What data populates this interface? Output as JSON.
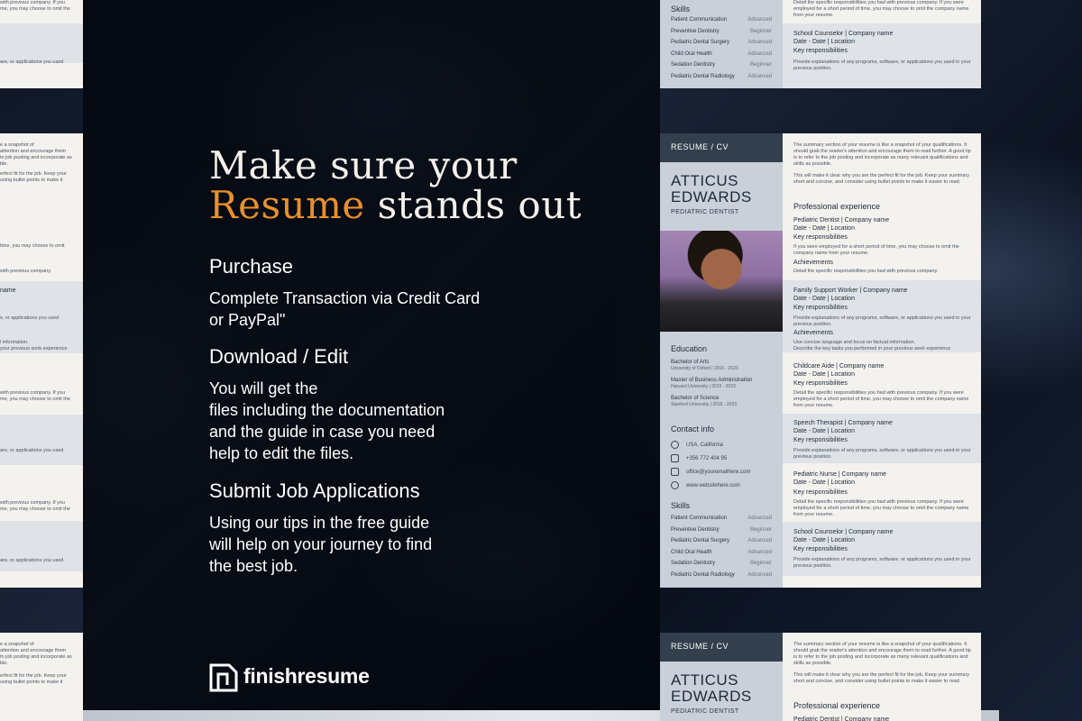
{
  "headline": {
    "line1": "Make sure your",
    "accent": "Resume",
    "rest": " stands out"
  },
  "steps": [
    {
      "title": "Purchase",
      "body": "Complete Transaction via Credit Card\nor PayPal\""
    },
    {
      "title": "Download / Edit",
      "body": "You will get the\nfiles including the documentation\nand the guide in case you need\nhelp to edit the files."
    },
    {
      "title": "Submit Job Applications",
      "body": "Using our tips in the free guide\nwill help on your journey to find\nthe best job."
    }
  ],
  "brand": {
    "name": "finishresume"
  },
  "resume": {
    "header": "RESUME / CV",
    "first_name": "ATTICUS",
    "last_name": "EDWARDS",
    "role": "PEDIATRIC DENTIST",
    "education_title": "Education",
    "education": [
      {
        "degree": "Bachelor of Arts",
        "school": "University of Oxford | 2016 - 2023"
      },
      {
        "degree": "Master of Business Administration",
        "school": "Harvard University | 2016 - 2023"
      },
      {
        "degree": "Bachelor of Science",
        "school": "Stanford University | 2016 - 2023"
      }
    ],
    "contact_title": "Contact info",
    "contact": [
      "USA, California",
      "+356 772 404 95",
      "office@youremailhere.com",
      "www.websitehere.com"
    ],
    "skills_title": "Skills",
    "skills": [
      {
        "name": "Patient Communication",
        "level": "Advanced"
      },
      {
        "name": "Preventive Dentistry",
        "level": "Beginner"
      },
      {
        "name": "Pediatric Dental Surgery",
        "level": "Advanced"
      },
      {
        "name": "Child Oral Health",
        "level": "Advanced"
      },
      {
        "name": "Sedation Dentistry",
        "level": "Beginner"
      },
      {
        "name": "Pediatric Dental Radiology",
        "level": "Advanced"
      }
    ],
    "summary": "The summary section of your resume is like a snapshot of your qualifications. It should grab the reader's attention and encourage them to read further. A good tip is to refer to the job posting and incorporate as many relevant qualifications and skills as possible.",
    "summary2": "This will make it clear why you are the perfect fit for the job. Keep your summary short and concise, and consider using bullet points to make it easier to read.",
    "experience_title": "Professional experience",
    "key_resp": "Key responsibilities",
    "achievements": "Achievements",
    "date_loc": "Date - Date | Location",
    "resp_text": "If you were employed for a short period of time, you may choose to omit the company name from your resume.",
    "resp_text2": "Detail the specific responsibilities you had with previous company. If you were employed for a short period of time, you may choose to omit the company name from your resume.",
    "prog_text": "Provide explanations of any programs, software, or applications you used in your previous position.",
    "achv_text": "Detail the specific responsibilities you had with previous company.",
    "achv_text2": "Use concise language and focus on factual information.\nDescribe the key tasks you performed in your previous work experience",
    "jobs": [
      "Pediatric Dentist | Company name",
      "Family Support Worker | Company name",
      "Childcare Aide | Company name",
      "Speech Therapist | Company name",
      "Pediatric Nurse | Company name",
      "School Counselor | Company name"
    ],
    "top_resp": "Detail the specific responsibilities you had with previous company. If you were employed for a short period of time, you may choose to omit the company name from your resume."
  },
  "edge_texts": {
    "left1": "e a snapshot of\nattention and encourage them\nto job posting and incorporate as\nble.",
    "left2": "erfect fit for the job. Keep your\nusing bullet points to make it",
    "left3": "time, you may choose to omit",
    "left4": "with previous company.",
    "left5": "name",
    "left6": "s, or applications you used",
    "left7": "l information.\nyour previous work experience",
    "left8": "with previous company. If you\nme, you may choose to omit the",
    "left9": "are, or applications you used",
    "left10": "with previous company. If you\nme, you may choose to omit the",
    "left11": "are, or applications you used",
    "left_top": "with previous company. If you\nme, you may choose to omit the",
    "left_top2": "are, or applications you used",
    "left_bottom": "e a snapshot of\nattention and encourage them\nto job posting and incorporate as\nble.\n\nerfect fit for the job. Keep your\nusing bullet points to make it"
  }
}
